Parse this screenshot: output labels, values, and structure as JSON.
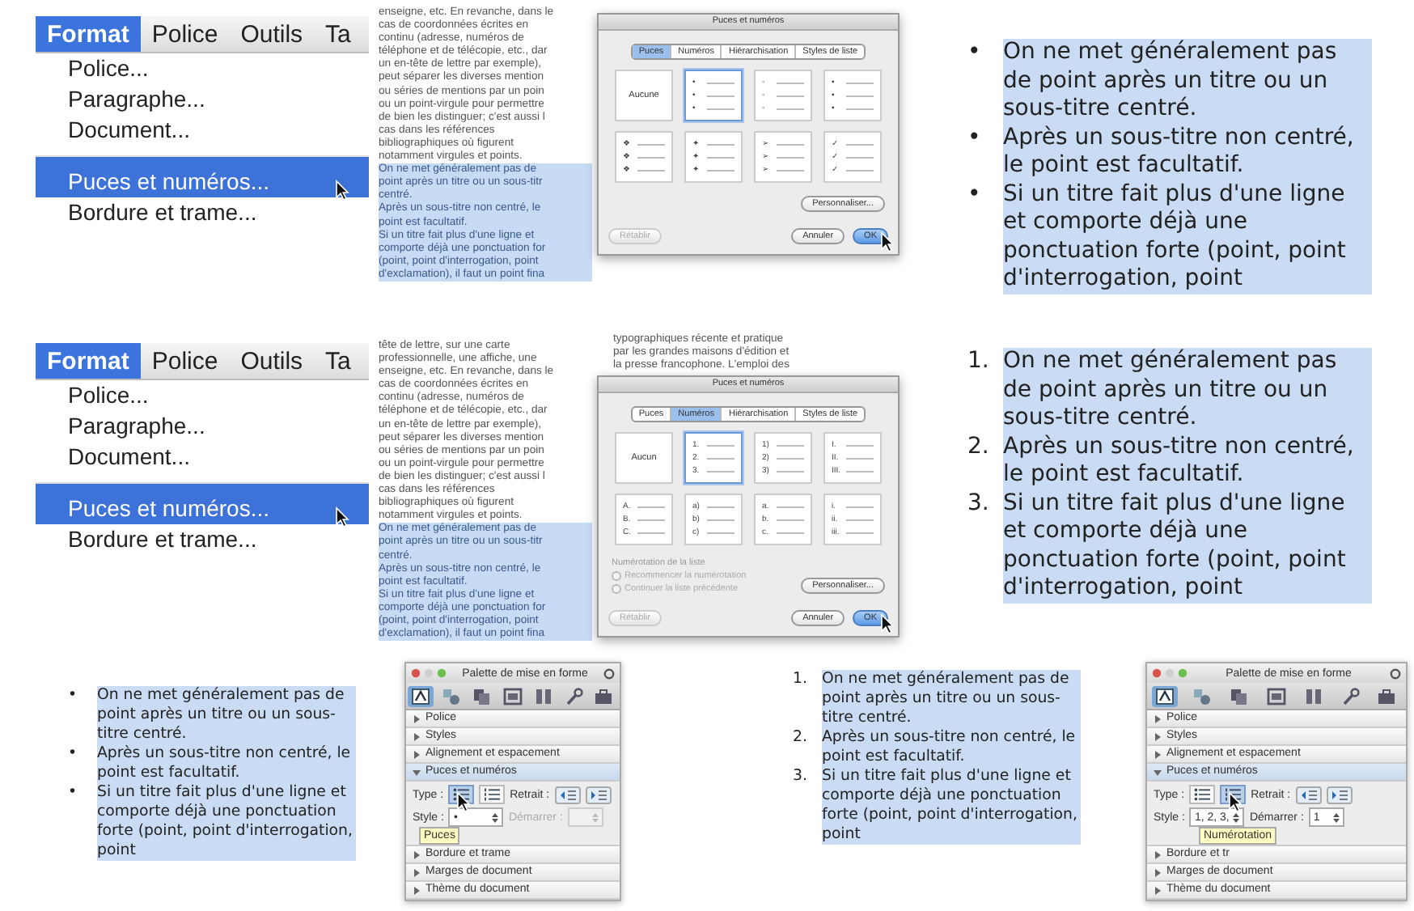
{
  "rows": [
    {
      "menu": {
        "bar": [
          {
            "label": "Format",
            "selected": true
          },
          {
            "label": "Police",
            "selected": false
          },
          {
            "label": "Outils",
            "selected": false
          },
          {
            "label": "Ta",
            "selected": false
          }
        ],
        "items": [
          {
            "label": "Police...",
            "selected": false,
            "separator_before": false
          },
          {
            "label": "Paragraphe...",
            "selected": false,
            "separator_before": false
          },
          {
            "label": "Document...",
            "selected": false,
            "separator_before": false
          },
          {
            "label": "Puces et numéros...",
            "selected": true,
            "separator_before": true
          },
          {
            "label": "Bordure et trame...",
            "selected": false,
            "separator_before": false
          }
        ]
      },
      "document": {
        "lines": [
          {
            "text": "enseigne, etc. En revanche, dans le",
            "highlighted": false
          },
          {
            "text": "cas de coordonnées écrites en",
            "highlighted": false
          },
          {
            "text": "continu (adresse, numéros de",
            "highlighted": false
          },
          {
            "text": "téléphone et de télécopie, etc., dar",
            "highlighted": false
          },
          {
            "text": "un en-tête de lettre par exemple),",
            "highlighted": false
          },
          {
            "text": "peut séparer les diverses mention",
            "highlighted": false
          },
          {
            "text": "ou séries de mentions par un poin",
            "highlighted": false
          },
          {
            "text": "ou un point-virgule pour permettre",
            "highlighted": false
          },
          {
            "text": "de bien les distinguer; c'est aussi l",
            "highlighted": false
          },
          {
            "text": "cas dans les références",
            "highlighted": false
          },
          {
            "text": "bibliographiques où figurent",
            "highlighted": false
          },
          {
            "text": "notamment virgules et points.",
            "highlighted": false
          },
          {
            "text": "On ne met généralement pas de",
            "highlighted": true
          },
          {
            "text": "point après un titre ou un sous-titr",
            "highlighted": true
          },
          {
            "text": "centré.",
            "highlighted": true
          },
          {
            "text": "Après un sous-titre non centré, le",
            "highlighted": true
          },
          {
            "text": "point est facultatif.",
            "highlighted": true
          },
          {
            "text": "Si un titre fait plus d'une ligne et",
            "highlighted": true
          },
          {
            "text": "comporte déjà une ponctuation for",
            "highlighted": true
          },
          {
            "text": "(point, point d'interrogation, point",
            "highlighted": true
          },
          {
            "text": "d'exclamation), il faut un point fina",
            "highlighted": true
          }
        ]
      },
      "dialog": {
        "title": "Puces et numéros",
        "tabs": [
          {
            "label": "Puces",
            "selected": true
          },
          {
            "label": "Numéros",
            "selected": false
          },
          {
            "label": "Hiérarchisation",
            "selected": false
          },
          {
            "label": "Styles de liste",
            "selected": false
          }
        ],
        "styles": [
          {
            "kind": "none",
            "label": "Aucune",
            "selected": false
          },
          {
            "kind": "marked",
            "markers": [
              "•",
              "•",
              "•"
            ],
            "selected": true
          },
          {
            "kind": "marked",
            "markers": [
              "◦",
              "◦",
              "◦"
            ],
            "selected": false
          },
          {
            "kind": "marked",
            "markers": [
              "▪",
              "▪",
              "▪"
            ],
            "selected": false
          },
          {
            "kind": "marked",
            "markers": [
              "❖",
              "❖",
              "❖"
            ],
            "selected": false
          },
          {
            "kind": "marked",
            "markers": [
              "✦",
              "✦",
              "✦"
            ],
            "selected": false
          },
          {
            "kind": "marked",
            "markers": [
              "➢",
              "➢",
              "➢"
            ],
            "selected": false
          },
          {
            "kind": "marked",
            "markers": [
              "✓",
              "✓",
              "✓"
            ],
            "selected": false
          }
        ],
        "customize_button": "Personnaliser...",
        "buttons": [
          {
            "label": "Rétablir",
            "disabled": true,
            "default": false
          },
          {
            "label": "Annuler",
            "disabled": false,
            "default": false
          },
          {
            "label": "OK",
            "disabled": false,
            "default": true
          }
        ]
      },
      "result": {
        "items": [
          {
            "marker": "•",
            "text": "On ne met généralement pas de point après un titre ou un sous-titre centré."
          },
          {
            "marker": "•",
            "text": "Après un sous-titre non centré, le point est facultatif."
          },
          {
            "marker": "•",
            "text": "Si un titre fait plus d'une ligne et comporte déjà une ponctuation forte (point, point d'interrogation, point"
          }
        ]
      }
    },
    {
      "menu": {
        "bar": [
          {
            "label": "Format",
            "selected": true
          },
          {
            "label": "Police",
            "selected": false
          },
          {
            "label": "Outils",
            "selected": false
          },
          {
            "label": "Ta",
            "selected": false
          }
        ],
        "items": [
          {
            "label": "Police...",
            "selected": false,
            "separator_before": false
          },
          {
            "label": "Paragraphe...",
            "selected": false,
            "separator_before": false
          },
          {
            "label": "Document...",
            "selected": false,
            "separator_before": false
          },
          {
            "label": "Puces et numéros...",
            "selected": true,
            "separator_before": true
          },
          {
            "label": "Bordure et trame...",
            "selected": false,
            "separator_before": false
          }
        ]
      },
      "document": {
        "column_2": [
          "typographiques récente et pratique",
          "par les grandes maisons d'édition et",
          "la presse francophone. L'emploi des"
        ],
        "lines": [
          {
            "text": "tête de lettre, sur une carte",
            "highlighted": false
          },
          {
            "text": "professionnelle, une affiche, une",
            "highlighted": false
          },
          {
            "text": "enseigne, etc. En revanche, dans le",
            "highlighted": false
          },
          {
            "text": "cas de coordonnées écrites en",
            "highlighted": false
          },
          {
            "text": "continu (adresse, numéros de",
            "highlighted": false
          },
          {
            "text": "téléphone et de télécopie, etc., dar",
            "highlighted": false
          },
          {
            "text": "un en-tête de lettre par exemple),",
            "highlighted": false
          },
          {
            "text": "peut séparer les diverses mention",
            "highlighted": false
          },
          {
            "text": "ou séries de mentions par un poin",
            "highlighted": false
          },
          {
            "text": "ou un point-virgule pour permettre",
            "highlighted": false
          },
          {
            "text": "de bien les distinguer; c'est aussi l",
            "highlighted": false
          },
          {
            "text": "cas dans les références",
            "highlighted": false
          },
          {
            "text": "bibliographiques où figurent",
            "highlighted": false
          },
          {
            "text": "notamment virgules et points.",
            "highlighted": false
          },
          {
            "text": "On ne met généralement pas de",
            "highlighted": true
          },
          {
            "text": "point après un titre ou un sous-titr",
            "highlighted": true
          },
          {
            "text": "centré.",
            "highlighted": true
          },
          {
            "text": "Après un sous-titre non centré, le",
            "highlighted": true
          },
          {
            "text": "point est facultatif.",
            "highlighted": true
          },
          {
            "text": "Si un titre fait plus d'une ligne et",
            "highlighted": true
          },
          {
            "text": "comporte déjà une ponctuation for",
            "highlighted": true
          },
          {
            "text": "(point, point d'interrogation, point",
            "highlighted": true
          },
          {
            "text": "d'exclamation), il faut un point fina",
            "highlighted": true
          }
        ]
      },
      "dialog": {
        "title": "Puces et numéros",
        "tabs": [
          {
            "label": "Puces",
            "selected": false
          },
          {
            "label": "Numéros",
            "selected": true
          },
          {
            "label": "Hiérarchisation",
            "selected": false
          },
          {
            "label": "Styles de liste",
            "selected": false
          }
        ],
        "styles": [
          {
            "kind": "none",
            "label": "Aucun",
            "selected": false
          },
          {
            "kind": "marked",
            "markers": [
              "1.",
              "2.",
              "3."
            ],
            "selected": true
          },
          {
            "kind": "marked",
            "markers": [
              "1)",
              "2)",
              "3)"
            ],
            "selected": false
          },
          {
            "kind": "marked",
            "markers": [
              "I.",
              "II.",
              "III."
            ],
            "selected": false
          },
          {
            "kind": "marked",
            "markers": [
              "A.",
              "B.",
              "C."
            ],
            "selected": false
          },
          {
            "kind": "marked",
            "markers": [
              "a)",
              "b)",
              "c)"
            ],
            "selected": false
          },
          {
            "kind": "marked",
            "markers": [
              "a.",
              "b.",
              "c."
            ],
            "selected": false
          },
          {
            "kind": "marked",
            "markers": [
              "i.",
              "ii.",
              "iii."
            ],
            "selected": false
          }
        ],
        "numbering": {
          "label": "Numérotation de la liste",
          "options": [
            {
              "label": "Recommencer la numérotation",
              "selected": false,
              "disabled": true
            },
            {
              "label": "Continuer la liste précédente",
              "selected": false,
              "disabled": true
            }
          ]
        },
        "customize_button": "Personnaliser...",
        "buttons": [
          {
            "label": "Rétablir",
            "disabled": true,
            "default": false
          },
          {
            "label": "Annuler",
            "disabled": false,
            "default": false
          },
          {
            "label": "OK",
            "disabled": false,
            "default": true
          }
        ]
      },
      "result": {
        "items": [
          {
            "marker": "1.",
            "text": "On ne met généralement pas de point après un titre ou un sous-titre centré."
          },
          {
            "marker": "2.",
            "text": "Après un sous-titre non centré, le point est facultatif."
          },
          {
            "marker": "3.",
            "text": "Si un titre fait plus d'une ligne et comporte déjà une ponctuation forte (point, point d'interrogation, point"
          }
        ]
      }
    }
  ],
  "bottom_row": [
    {
      "kind": "list",
      "items": [
        {
          "marker": "•",
          "text": "On ne met généralement pas de point après un titre ou un sous-titre centré."
        },
        {
          "marker": "•",
          "text": "Après un sous-titre non centré, le point est facultatif."
        },
        {
          "marker": "•",
          "text": "Si un titre fait plus d'une ligne et comporte déjà une ponctuation forte (point, point d'interrogation, point"
        }
      ]
    },
    {
      "kind": "palette",
      "title": "Palette de mise en forme",
      "toolbar": [
        {
          "selected": true
        },
        {
          "selected": false
        },
        {
          "selected": false
        },
        {
          "selected": false
        },
        {
          "selected": false
        },
        {
          "selected": false
        },
        {
          "selected": false
        }
      ],
      "sections": [
        {
          "label": "Police",
          "expanded": false
        },
        {
          "label": "Styles",
          "expanded": false
        },
        {
          "label": "Alignement et espacement",
          "expanded": false
        },
        {
          "label": "Puces et numéros",
          "expanded": true
        },
        {
          "label": "Bordure et trame",
          "expanded": false
        },
        {
          "label": "Marges de document",
          "expanded": false
        },
        {
          "label": "Thème du document",
          "expanded": false
        }
      ],
      "controls": {
        "type_label": "Type :",
        "type_options": [
          {
            "kind": "bullets",
            "selected": true
          },
          {
            "kind": "numbers",
            "selected": false
          }
        ],
        "indent_label": "Retrait :",
        "style_label": "Style :",
        "style_value": "•",
        "start_label": "Démarrer :",
        "start_disabled": true,
        "tooltip": "Puces"
      }
    },
    {
      "kind": "list",
      "items": [
        {
          "marker": "1.",
          "text": "On ne met généralement pas de point après un titre ou un sous-titre centré."
        },
        {
          "marker": "2.",
          "text": "Après un sous-titre non centré, le point est facultatif."
        },
        {
          "marker": "3.",
          "text": "Si un titre fait plus d'une ligne et comporte déjà une ponctuation forte (point, point d'interrogation, point"
        }
      ]
    },
    {
      "kind": "palette",
      "title": "Palette de mise en forme",
      "toolbar": [
        {
          "selected": true
        },
        {
          "selected": false
        },
        {
          "selected": false
        },
        {
          "selected": false
        },
        {
          "selected": false
        },
        {
          "selected": false
        },
        {
          "selected": false
        }
      ],
      "sections": [
        {
          "label": "Police",
          "expanded": false
        },
        {
          "label": "Styles",
          "expanded": false
        },
        {
          "label": "Alignement et espacement",
          "expanded": false
        },
        {
          "label": "Puces et numéros",
          "expanded": true
        },
        {
          "label": "Bordure et tr",
          "expanded": false
        },
        {
          "label": "Marges de document",
          "expanded": false
        },
        {
          "label": "Thème du document",
          "expanded": false
        }
      ],
      "controls": {
        "type_label": "Type :",
        "type_options": [
          {
            "kind": "bullets",
            "selected": false
          },
          {
            "kind": "numbers",
            "selected": true
          }
        ],
        "indent_label": "Retrait :",
        "style_label": "Style :",
        "style_value": "1, 2, 3,",
        "start_label": "Démarrer :",
        "start_value": "1",
        "start_disabled": false,
        "tooltip": "Numérotation"
      }
    }
  ]
}
